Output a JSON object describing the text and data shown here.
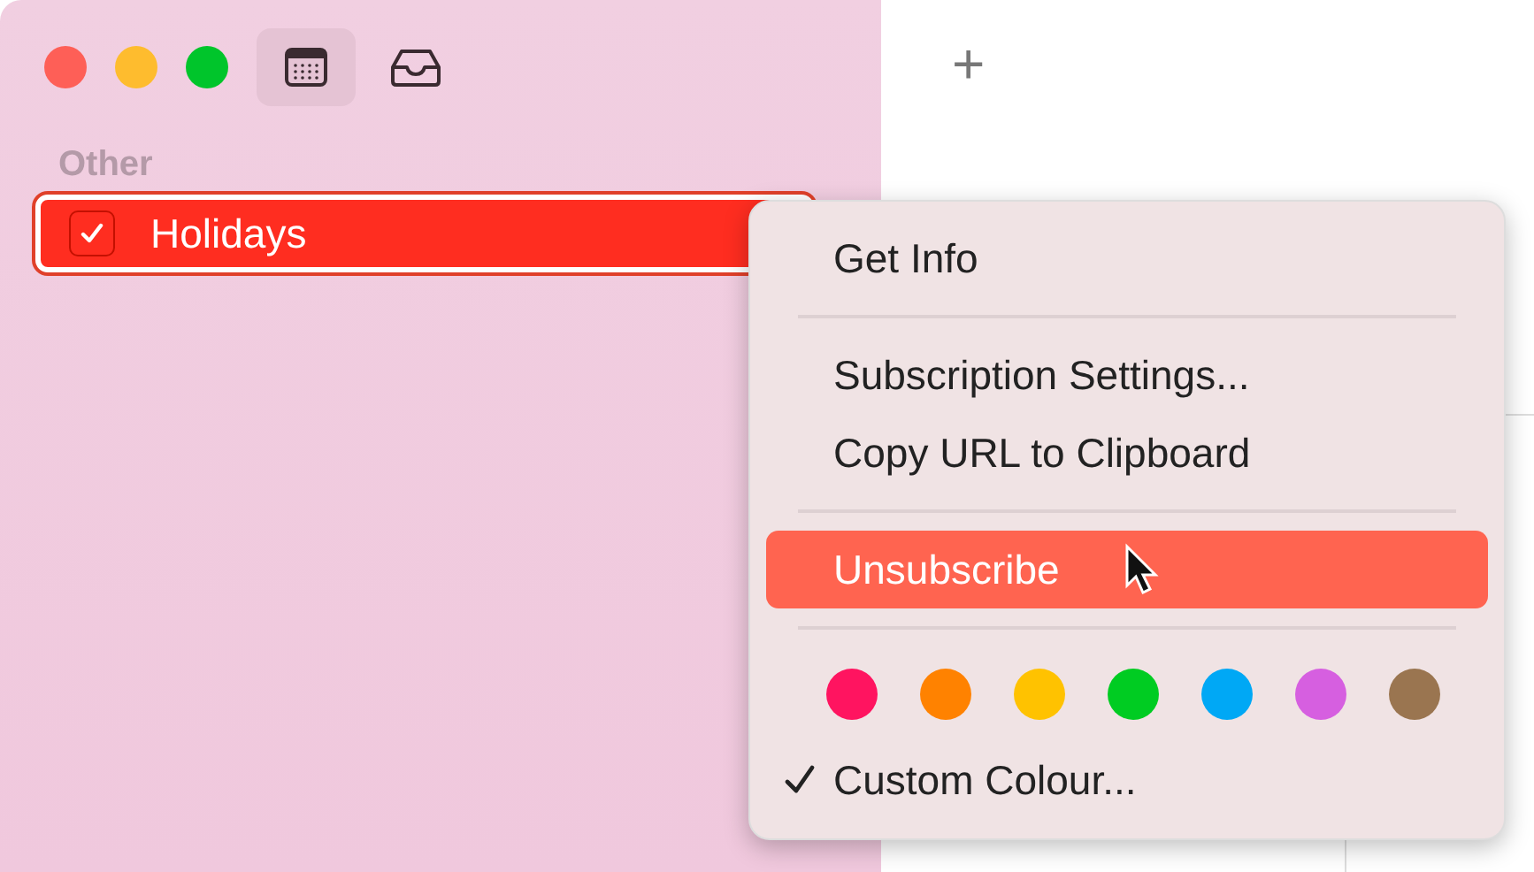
{
  "toolbar": {
    "buttons": [
      {
        "kind": "calendar",
        "selected": true
      },
      {
        "kind": "inbox",
        "selected": false
      }
    ]
  },
  "sidebar": {
    "section": "Other",
    "calendars": [
      {
        "label": "Holidays",
        "checked": true,
        "selected": true,
        "color": "#ff2d20"
      }
    ]
  },
  "main": {
    "add_button": "+"
  },
  "context_menu": {
    "items": [
      {
        "kind": "item",
        "label": "Get Info",
        "highlighted": false,
        "checked": false
      },
      {
        "kind": "separator"
      },
      {
        "kind": "item",
        "label": "Subscription Settings...",
        "highlighted": false,
        "checked": false
      },
      {
        "kind": "item",
        "label": "Copy URL to Clipboard",
        "highlighted": false,
        "checked": false
      },
      {
        "kind": "separator"
      },
      {
        "kind": "item",
        "label": "Unsubscribe",
        "highlighted": true,
        "checked": false
      },
      {
        "kind": "separator"
      },
      {
        "kind": "swatches",
        "colors": [
          {
            "color": "#ff1460"
          },
          {
            "color": "#ff8200"
          },
          {
            "color": "#ffc200"
          },
          {
            "color": "#00cc22"
          },
          {
            "color": "#00a8f5"
          },
          {
            "color": "#d65fe0"
          },
          {
            "color": "#9a7550"
          }
        ]
      },
      {
        "kind": "item",
        "label": "Custom Colour...",
        "highlighted": false,
        "checked": true
      }
    ]
  }
}
